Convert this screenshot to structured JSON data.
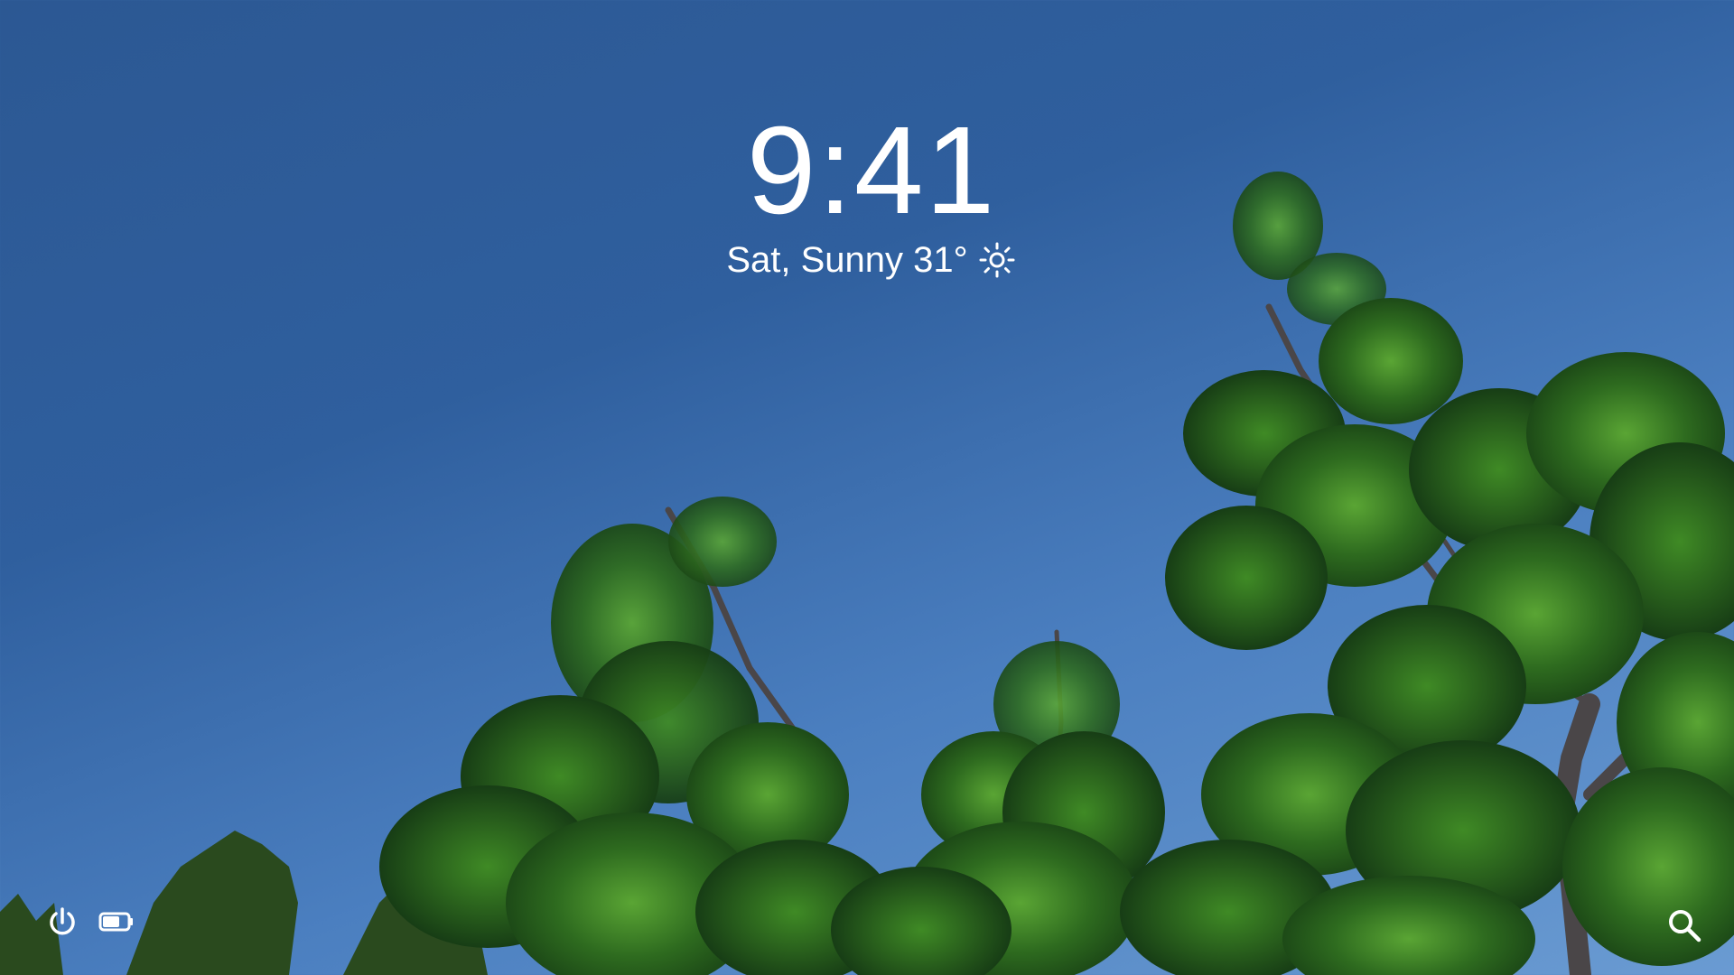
{
  "lockscreen": {
    "time": "9:41",
    "date_weather": "Sat, Sunny 31°",
    "weather_icon": "sun-icon"
  },
  "tray": {
    "power_icon": "power-icon",
    "battery_icon": "battery-icon",
    "search_icon": "search-icon"
  },
  "colors": {
    "sky_top": "#2c5893",
    "sky_bottom": "#6a9bd2",
    "foliage": "#2e6b1f",
    "foliage_light": "#4d9a2a",
    "foliage_dark": "#16401a",
    "branch": "#3d3a3c"
  }
}
